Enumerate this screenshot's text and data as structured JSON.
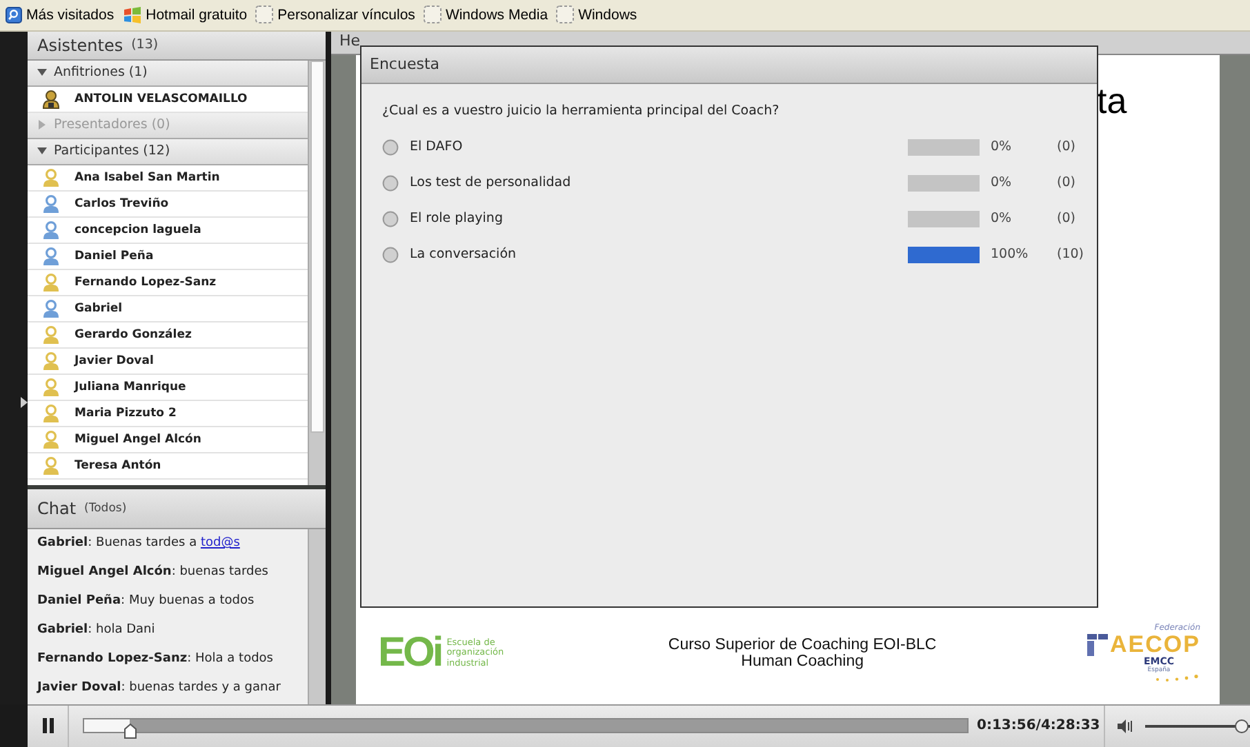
{
  "bookmarks": [
    {
      "kind": "search",
      "label": "Más visitados"
    },
    {
      "kind": "windows",
      "label": "Hotmail gratuito"
    },
    {
      "kind": "page",
      "label": "Personalizar vínculos"
    },
    {
      "kind": "page",
      "label": "Windows Media"
    },
    {
      "kind": "page",
      "label": "Windows"
    }
  ],
  "attendees": {
    "title": "Asistentes",
    "count": "(13)",
    "groups": [
      {
        "label": "Anfitriones (1)",
        "expanded": true,
        "disabled": false,
        "members": [
          {
            "name": "ANTOLIN VELASCOMAILLO",
            "kind": "host",
            "color": "#c9a23a"
          }
        ]
      },
      {
        "label": "Presentadores (0)",
        "expanded": false,
        "disabled": true
      },
      {
        "label": "Participantes (12)",
        "expanded": true,
        "disabled": false,
        "members": [
          {
            "name": "Ana Isabel San Martin",
            "kind": "participant",
            "color": "#e0c050"
          },
          {
            "name": "Carlos Treviño",
            "kind": "participant",
            "color": "#6f9fd8"
          },
          {
            "name": "concepcion laguela",
            "kind": "participant",
            "color": "#6f9fd8"
          },
          {
            "name": "Daniel Peña",
            "kind": "participant",
            "color": "#6f9fd8"
          },
          {
            "name": "Fernando Lopez-Sanz",
            "kind": "participant",
            "color": "#e0c050"
          },
          {
            "name": "Gabriel",
            "kind": "participant",
            "color": "#6f9fd8"
          },
          {
            "name": "Gerardo González",
            "kind": "participant",
            "color": "#e0c050"
          },
          {
            "name": "Javier Doval",
            "kind": "participant",
            "color": "#e0c050"
          },
          {
            "name": "Juliana Manrique",
            "kind": "participant",
            "color": "#e0c050"
          },
          {
            "name": "Maria Pizzuto 2",
            "kind": "participant",
            "color": "#e0c050"
          },
          {
            "name": "Miguel Angel Alcón",
            "kind": "participant",
            "color": "#e0c050"
          },
          {
            "name": "Teresa Antón",
            "kind": "participant",
            "color": "#e0c050"
          }
        ]
      }
    ]
  },
  "chat": {
    "title": "Chat",
    "scope": "(Todos)",
    "messages": [
      {
        "text": "**Gabriel**: Buenas tardes a ",
        "link": "tod@s"
      },
      {
        "text": "**Miguel Angel Alcón**: buenas tardes"
      },
      {
        "text": "**Daniel Peña**: Muy buenas a todos"
      },
      {
        "text": "**Gabriel**: hola Dani"
      },
      {
        "text": "**Fernando Lopez-Sanz**: Hola a todos"
      },
      {
        "text": "**Javier Doval**: buenas tardes  y a ganar"
      }
    ]
  },
  "content": {
    "title": "He",
    "slide_text": "ta",
    "course": [
      "Curso Superior de Coaching EOI-BLC",
      "Human Coaching"
    ],
    "left_logo": {
      "mark": "EOi",
      "lines": [
        "Escuela de",
        "organización",
        "industrial"
      ]
    },
    "right_logo": {
      "top": "Federación",
      "mark": "AECOP",
      "sub": "EMCC",
      "country": "España"
    }
  },
  "poll": {
    "title": "Encuesta",
    "question": "¿Cual es a vuestro juicio la herramienta principal del Coach?",
    "options": [
      {
        "label": "El DAFO",
        "selected": false,
        "level": 0,
        "percent": "0%",
        "count": "(0)"
      },
      {
        "label": "Los test de personalidad",
        "selected": false,
        "level": 0,
        "percent": "0%",
        "count": "(0)"
      },
      {
        "label": "El role playing",
        "selected": false,
        "level": 0,
        "percent": "0%",
        "count": "(0)"
      },
      {
        "label": "La conversación",
        "selected": false,
        "level": 1,
        "percent": "100%",
        "count": "(10)"
      }
    ]
  },
  "player": {
    "playing": true,
    "progress": {
      "level": 0.052
    },
    "time": "0:13:56/4:28:33",
    "volume": {
      "level": 1
    }
  }
}
